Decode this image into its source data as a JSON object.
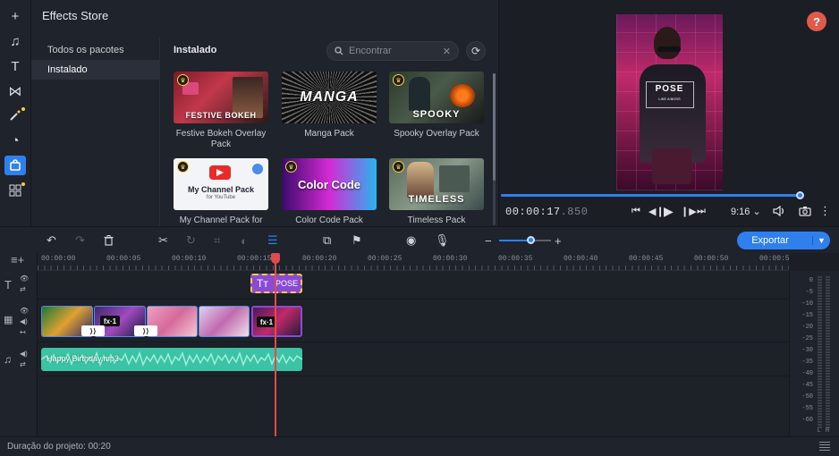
{
  "sidebar": {
    "icons": [
      "plus-icon",
      "music-icon",
      "text-icon",
      "transition-icon",
      "magic-wand-icon",
      "clock-icon",
      "store-icon",
      "more-apps-icon"
    ]
  },
  "store": {
    "title": "Effects Store",
    "nav": [
      "Todos os pacotes",
      "Instalado"
    ],
    "section_title": "Instalado",
    "search_placeholder": "Encontrar",
    "packs": [
      {
        "thumb_text": "FESTIVE BOKEH",
        "label": "Festive Bokeh Overlay Pack"
      },
      {
        "thumb_text": "MANGA",
        "label": "Manga Pack"
      },
      {
        "thumb_text": "SPOOKY",
        "label": "Spooky Overlay Pack"
      },
      {
        "thumb_text": "My Channel Pack",
        "thumb_sub": "for YouTube",
        "label": "My Channel Pack for"
      },
      {
        "thumb_text": "Color Code",
        "label": "Color Code Pack"
      },
      {
        "thumb_text": "TIMELESS",
        "label": "Timeless Pack"
      }
    ]
  },
  "preview": {
    "help": "?",
    "title_overlay": "POSE",
    "subtitle_overlay": "LIKE A BOSS",
    "time_main": "00:00:17",
    "time_ms": ".850",
    "aspect_ratio": "9:16 ⌄",
    "progress": 0.99
  },
  "toolbar": {
    "export_label": "Exportar",
    "zoom": 0.6
  },
  "timeline": {
    "ticks": [
      "00:00:00",
      "00:00:05",
      "00:00:10",
      "00:00:15",
      "00:00:20",
      "00:00:25",
      "00:00:30",
      "00:00:35",
      "00:00:40",
      "00:00:45",
      "00:00:50",
      "00:00:5"
    ],
    "title_clip": "POSE",
    "fx_badge": "fx·1",
    "audio_clip": "Happy Birthday.mp3",
    "vu_scale": [
      "0",
      "-5",
      "-10",
      "-15",
      "-20",
      "-25",
      "-30",
      "-35",
      "-40",
      "-45",
      "-50",
      "-55",
      "-60"
    ],
    "vu_channels": [
      "L",
      "R"
    ]
  },
  "status": {
    "duration": "Duração do projeto: 00:20"
  }
}
